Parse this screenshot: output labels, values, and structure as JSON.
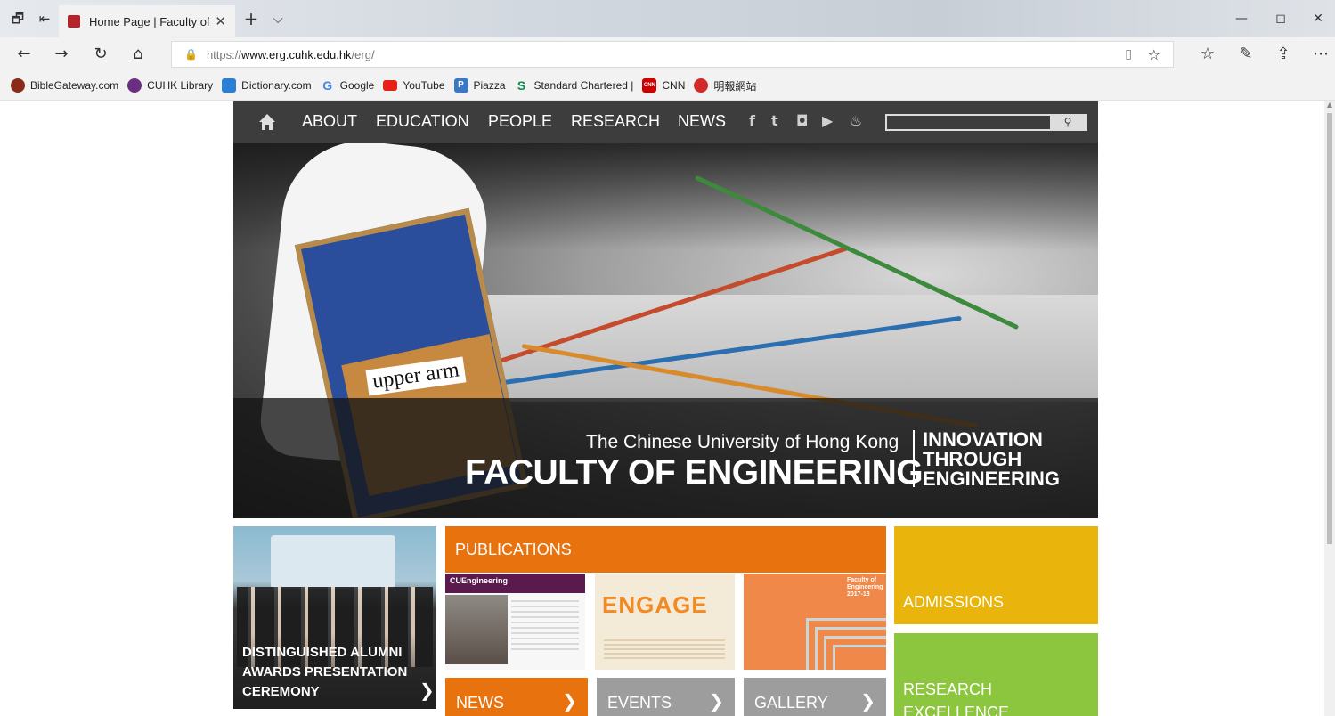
{
  "browser": {
    "tab_title": "Home Page | Faculty of",
    "tab_close": "✕",
    "new_tab": "+",
    "tab_list": "⌵",
    "url_scheme": "https://",
    "url_host": "www.erg.cuhk.edu.hk",
    "url_path": "/erg/",
    "icons": {
      "tab_manager": "🗗",
      "back_tabs": "⇤",
      "back": "←",
      "forward": "→",
      "refresh": "↻",
      "home": "⌂",
      "lock": "🔒",
      "reading_view": "▯",
      "favorite": "☆",
      "favorites_hub": "☆",
      "notes": "✎",
      "share": "⇪",
      "more": "⋯",
      "minimize": "—",
      "maximize": "◻",
      "close": "✕"
    },
    "favorites": [
      {
        "label": "BibleGateway.com",
        "color": "#8a2b1a"
      },
      {
        "label": "CUHK Library",
        "color": "#6c2e83"
      },
      {
        "label": "Dictionary.com",
        "color": "#2a7fd4"
      },
      {
        "label": "Google",
        "color": "#4285f4",
        "glyph": "G"
      },
      {
        "label": "YouTube",
        "color": "#e62117"
      },
      {
        "label": "Piazza",
        "color": "#3a79c1",
        "glyph": "P"
      },
      {
        "label": "Standard Chartered |",
        "color": "#0a8a4a",
        "glyph": "S"
      },
      {
        "label": "CNN",
        "color": "#cc0000",
        "glyph": "CNN"
      },
      {
        "label": "明報網站",
        "color": "#d12a2a"
      }
    ]
  },
  "site": {
    "menu": [
      "ABOUT",
      "EDUCATION",
      "PEOPLE",
      "RESEARCH",
      "NEWS"
    ],
    "social": [
      "f",
      "t",
      "◘",
      "▶",
      "♨"
    ],
    "search_icon": "⚲",
    "hero": {
      "label": "upper arm",
      "subtitle": "The Chinese University of Hong Kong",
      "title": "FACULTY OF ENGINEERING",
      "slogan": [
        "INNOVATION",
        "THROUGH",
        "ENGINEERING"
      ]
    },
    "alumni": {
      "title": [
        "DISTINGUISHED ALUMNI",
        "AWARDS PRESENTATION",
        "CEREMONY"
      ],
      "arrow": "❯"
    },
    "publications": {
      "header": "PUBLICATIONS",
      "cue_label": "CUEngineering",
      "engage_label": "ENGAGE",
      "faculty_label": [
        "Faculty of",
        "Engineering",
        "2017-18"
      ]
    },
    "tiles": {
      "news": "NEWS",
      "events": "EVENTS",
      "gallery": "GALLERY",
      "arrow": "❯",
      "admissions": "ADMISSIONS",
      "research": [
        "RESEARCH",
        "EXCELLENCE"
      ]
    }
  }
}
